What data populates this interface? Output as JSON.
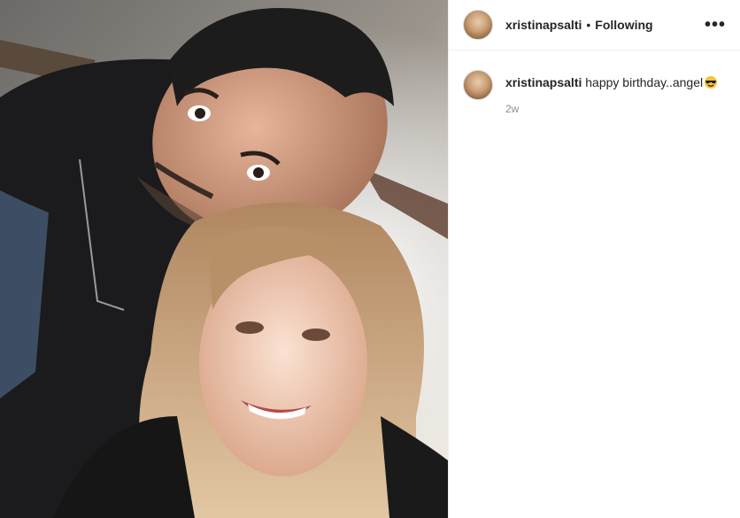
{
  "post": {
    "image_alt": "selfie photo",
    "header": {
      "username": "xristinapsalti",
      "separator": "•",
      "follow_label": "Following",
      "more_label": "•••"
    },
    "caption": {
      "username": "xristinapsalti",
      "text": "happy birthday..angel",
      "emoji": "face-with-sunglasses-icon",
      "time": "2w"
    }
  },
  "colors": {
    "text": "#262626",
    "muted": "#8e8e8e",
    "border": "#efefef"
  }
}
